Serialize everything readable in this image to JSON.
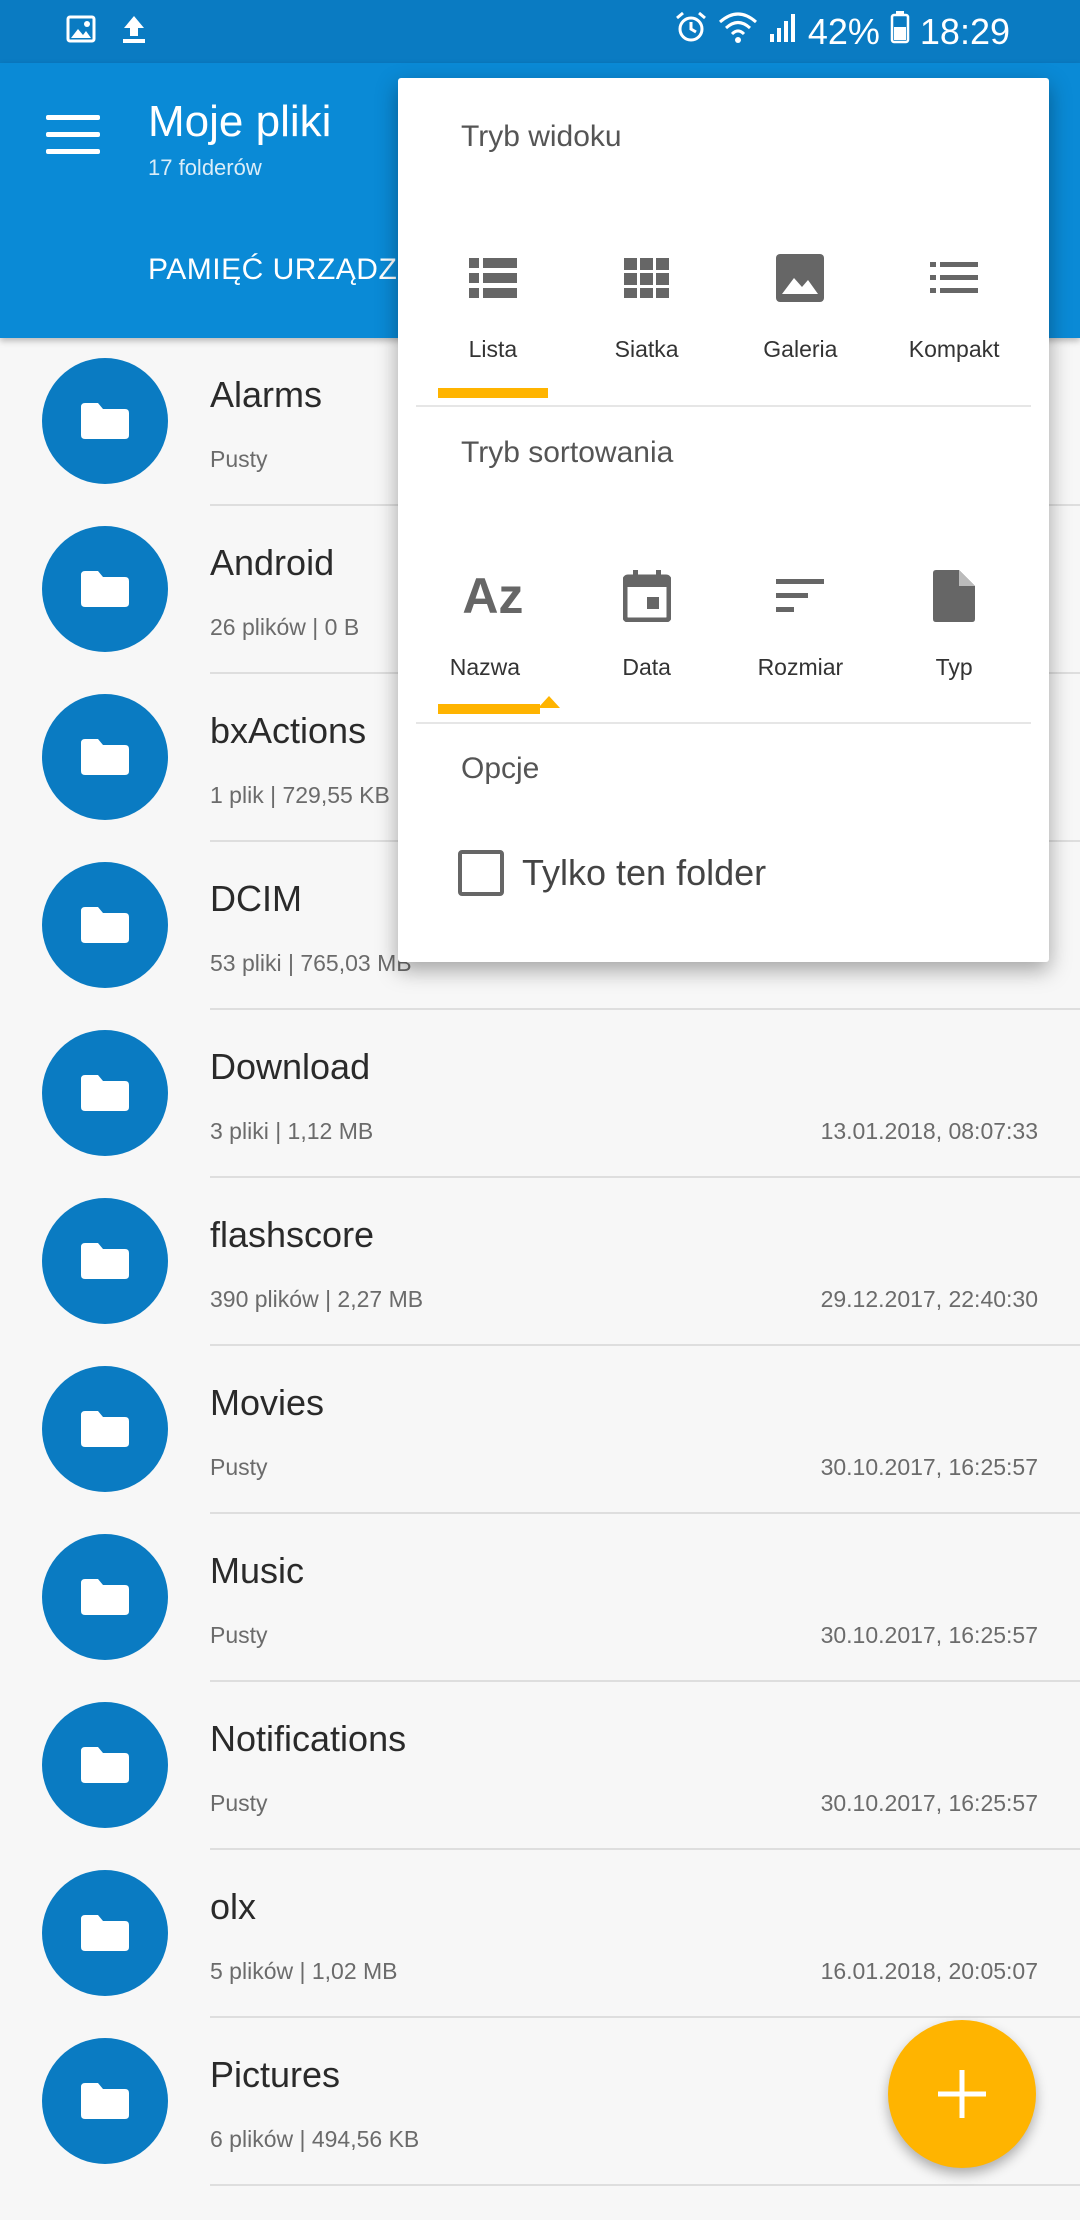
{
  "status_bar": {
    "battery": "42%",
    "time": "18:29",
    "icons": [
      "image-icon",
      "upload-icon",
      "alarm-icon",
      "wifi-icon",
      "signal-icon",
      "battery-icon"
    ]
  },
  "app_bar": {
    "title": "Moje pliki",
    "subtitle": "17 folderów",
    "storage_tab": "PAMIĘĆ URZĄDZ"
  },
  "files": [
    {
      "name": "Alarms",
      "meta": "Pusty",
      "date": ""
    },
    {
      "name": "Android",
      "meta": "26 plików  |  0 B",
      "date": ""
    },
    {
      "name": "bxActions",
      "meta": "1 plik  |  729,55 KB",
      "date": ""
    },
    {
      "name": "DCIM",
      "meta": "53 pliki  |  765,03 MB",
      "date": ""
    },
    {
      "name": "Download",
      "meta": "3 pliki  |  1,12 MB",
      "date": "13.01.2018, 08:07:33"
    },
    {
      "name": "flashscore",
      "meta": "390 plików  |  2,27 MB",
      "date": "29.12.2017, 22:40:30"
    },
    {
      "name": "Movies",
      "meta": "Pusty",
      "date": "30.10.2017, 16:25:57"
    },
    {
      "name": "Music",
      "meta": "Pusty",
      "date": "30.10.2017, 16:25:57"
    },
    {
      "name": "Notifications",
      "meta": "Pusty",
      "date": "30.10.2017, 16:25:57"
    },
    {
      "name": "olx",
      "meta": "5 plików  |  1,02 MB",
      "date": "16.01.2018, 20:05:07"
    },
    {
      "name": "Pictures",
      "meta": "6 plików  |  494,56 KB",
      "date": ""
    }
  ],
  "popup": {
    "view_mode_title": "Tryb widoku",
    "view_modes": [
      {
        "label": "Lista",
        "icon": "list-view-icon",
        "selected": true
      },
      {
        "label": "Siatka",
        "icon": "grid-view-icon",
        "selected": false
      },
      {
        "label": "Galeria",
        "icon": "gallery-view-icon",
        "selected": false
      },
      {
        "label": "Kompakt",
        "icon": "compact-view-icon",
        "selected": false
      }
    ],
    "sort_mode_title": "Tryb sortowania",
    "sort_modes": [
      {
        "label": "Nazwa",
        "icon": "sort-name-icon",
        "icon_text": "Az",
        "selected": true
      },
      {
        "label": "Data",
        "icon": "calendar-icon",
        "selected": false
      },
      {
        "label": "Rozmiar",
        "icon": "sort-size-icon",
        "selected": false
      },
      {
        "label": "Typ",
        "icon": "file-type-icon",
        "selected": false
      }
    ],
    "options_title": "Opcje",
    "only_this_folder": "Tylko ten folder",
    "only_this_folder_checked": false
  },
  "colors": {
    "status_bar": "#0a7bc2",
    "app_bar": "#0a8ad6",
    "accent": "#ffb400",
    "folder_icon_bg": "#0a7bc2"
  }
}
